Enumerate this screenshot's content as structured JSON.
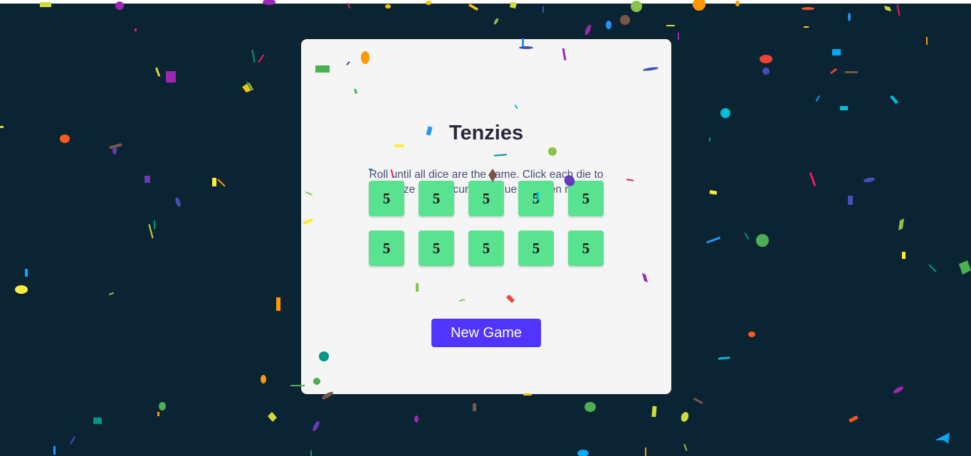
{
  "game": {
    "title": "Tenzies",
    "instructions": "Roll until all dice are the same. Click each die to freeze it at its current value between rolls.",
    "dice": [
      "5",
      "5",
      "5",
      "5",
      "5",
      "5",
      "5",
      "5",
      "5",
      "5"
    ],
    "new_game_label": "New Game"
  },
  "colors": {
    "background": "#0b2434",
    "card": "#f5f5f5",
    "die_held": "#59e391",
    "button": "#5035ff",
    "title_text": "#2b283a",
    "body_text": "#4a4e74"
  },
  "confetti": {
    "palette": [
      "#4caf50",
      "#8bc34a",
      "#cddc39",
      "#ffeb3b",
      "#ffc107",
      "#ff9800",
      "#ff5722",
      "#f44336",
      "#e91e63",
      "#9c27b0",
      "#673ab7",
      "#3f51b5",
      "#2196f3",
      "#03a9f4",
      "#00bcd4",
      "#009688",
      "#795548"
    ]
  }
}
